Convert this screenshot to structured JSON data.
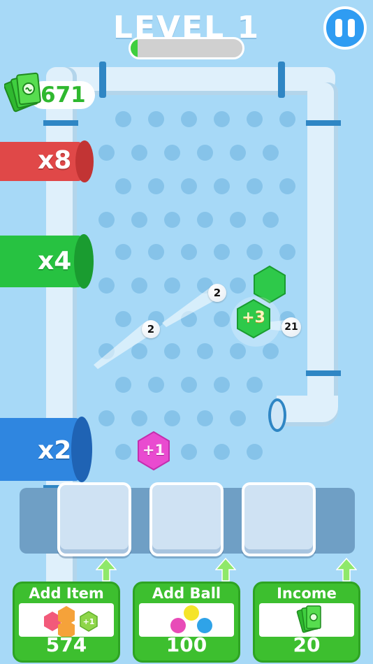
{
  "header": {
    "level_title": "LEVEL 1",
    "progress": 0.06
  },
  "wallet": {
    "money": "671",
    "icon": "cash-stack-icon"
  },
  "cannons": [
    {
      "label": "x8",
      "color": "#e85050"
    },
    {
      "label": "x4",
      "color": "#2ec94a"
    },
    {
      "label": "x2",
      "color": "#2f86e0"
    }
  ],
  "pickups": [
    {
      "label": "+3",
      "color": "#2ec94a"
    },
    {
      "label": "+1",
      "color": "#e94bd0"
    }
  ],
  "balls": [
    {
      "label": "2"
    },
    {
      "label": "2"
    },
    {
      "label": "21"
    }
  ],
  "upgrades": [
    {
      "title": "Add Item",
      "value": "574",
      "icon": "hexagon-items-icon"
    },
    {
      "title": "Add Ball",
      "value": "100",
      "icon": "colored-balls-icon"
    },
    {
      "title": "Income",
      "value": "20",
      "icon": "cash-stack-icon"
    }
  ],
  "colors": {
    "background": "#a7d9f7",
    "accent_green": "#3dbf2f",
    "pause_blue": "#2f9cf2"
  }
}
